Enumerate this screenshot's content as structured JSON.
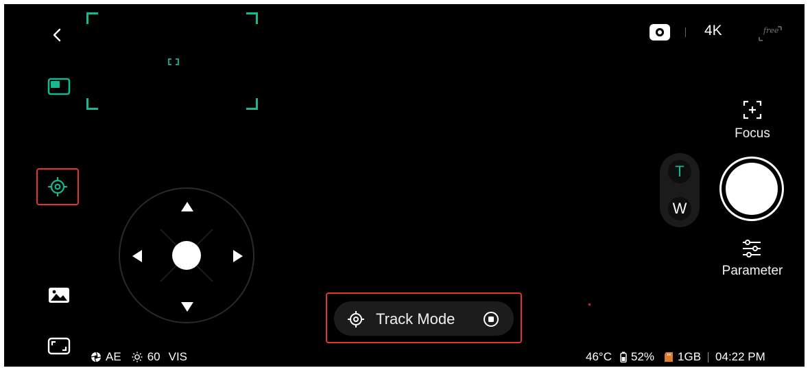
{
  "left_toolbar": {
    "back_icon": "chevron-left-icon",
    "pip_icon": "picture-in-picture-icon",
    "track_icon": "target-crosshair-icon",
    "gallery_icon": "gallery-image-icon",
    "fullscreen_icon": "fullscreen-expand-icon"
  },
  "top_right": {
    "camera_mode_icon": "camera-mode-icon",
    "resolution": "4K",
    "free_badge": "free"
  },
  "right_controls": {
    "focus_label": "Focus",
    "zoom_tele": "T",
    "zoom_wide": "W",
    "parameter_label": "Parameter"
  },
  "track_mode": {
    "label": "Track Mode"
  },
  "status_left": {
    "ae_label": "AE",
    "exposure": "60",
    "mode": "VIS"
  },
  "status_right": {
    "temperature": "46°C",
    "battery": "52%",
    "storage": "1GB",
    "time": "04:22 PM"
  },
  "colors": {
    "accent": "#17b890",
    "highlight": "#e0362f",
    "background": "#000000"
  }
}
